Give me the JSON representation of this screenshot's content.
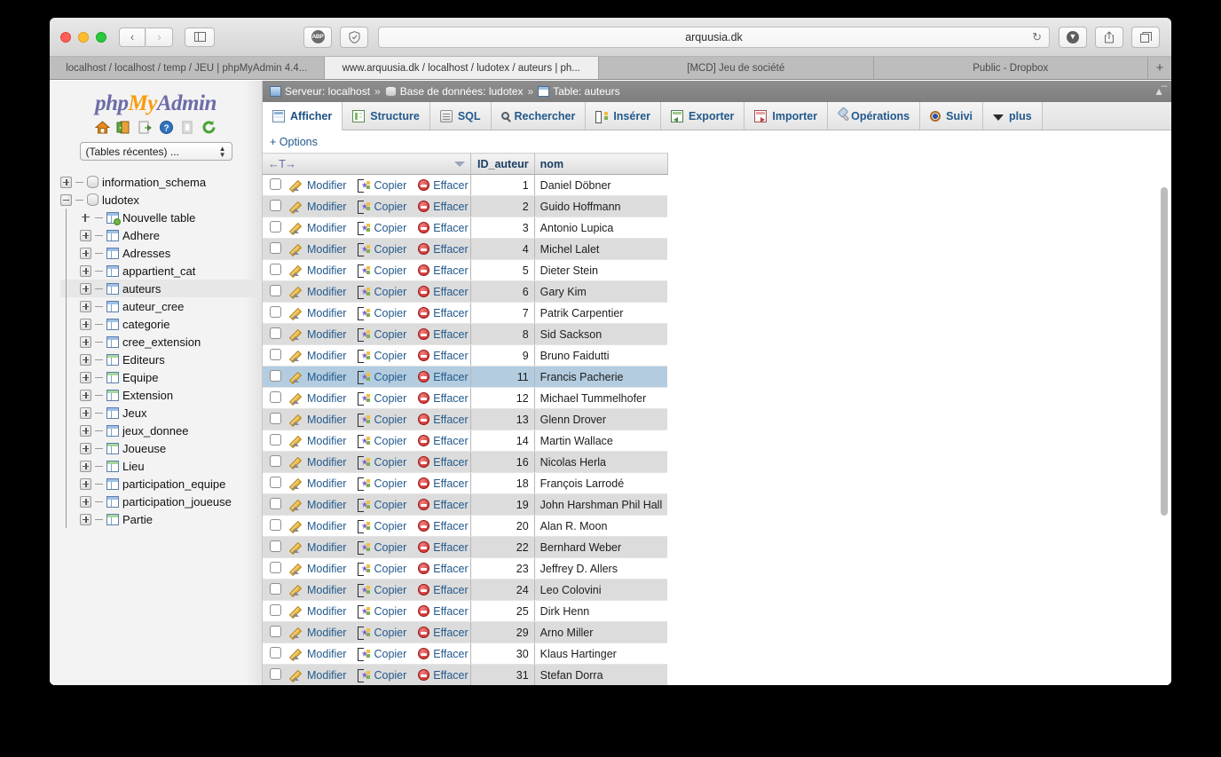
{
  "browser": {
    "url": "arquusia.dk",
    "reload_icon": "reload-icon",
    "back_icon": "chevron-left-icon",
    "forward_icon": "chevron-right-icon",
    "sidebar_icon": "sidebar-toggle-icon",
    "abp_label": "ABP",
    "shield_icon": "shield-icon",
    "download_icon": "download-icon",
    "share_icon": "share-icon",
    "tabs_overview_icon": "tabs-overview-icon",
    "new_tab_label": "+",
    "tabs": [
      {
        "label": "localhost / localhost / temp / JEU | phpMyAdmin 4.4...",
        "active": false
      },
      {
        "label": "www.arquusia.dk / localhost / ludotex / auteurs | ph...",
        "active": true
      },
      {
        "label": "[MCD] Jeu de société",
        "active": false
      },
      {
        "label": "Public - Dropbox",
        "active": false
      }
    ]
  },
  "sidebar": {
    "logo": {
      "php": "php",
      "my": "My",
      "admin": "Admin"
    },
    "nav_icons": [
      "home-icon",
      "exit-icon",
      "export-doc-icon",
      "help-icon",
      "doc-icon",
      "reload-icon"
    ],
    "recent_select": {
      "value": "(Tables récentes) ...",
      "arrows": "⬍"
    },
    "tree": [
      {
        "label": "information_schema",
        "type": "db",
        "level": 0,
        "expander": "plus",
        "selected": false
      },
      {
        "label": "ludotex",
        "type": "db",
        "level": 0,
        "expander": "minus",
        "selected": false
      },
      {
        "label": "Nouvelle table",
        "type": "newtable",
        "level": 1,
        "expander": "none",
        "selected": false
      },
      {
        "label": "Adhere",
        "type": "table",
        "level": 1,
        "expander": "plus",
        "selected": false
      },
      {
        "label": "Adresses",
        "type": "table",
        "level": 1,
        "expander": "plus",
        "selected": false
      },
      {
        "label": "appartient_cat",
        "type": "table",
        "level": 1,
        "expander": "plus",
        "selected": false
      },
      {
        "label": "auteurs",
        "type": "table",
        "level": 1,
        "expander": "plus",
        "selected": true
      },
      {
        "label": "auteur_cree",
        "type": "table",
        "level": 1,
        "expander": "plus",
        "selected": false
      },
      {
        "label": "categorie",
        "type": "table",
        "level": 1,
        "expander": "plus",
        "selected": false
      },
      {
        "label": "cree_extension",
        "type": "table",
        "level": 1,
        "expander": "plus",
        "selected": false
      },
      {
        "label": "Editeurs",
        "type": "table-green",
        "level": 1,
        "expander": "plus",
        "selected": false
      },
      {
        "label": "Equipe",
        "type": "table-green",
        "level": 1,
        "expander": "plus",
        "selected": false
      },
      {
        "label": "Extension",
        "type": "table-green",
        "level": 1,
        "expander": "plus",
        "selected": false
      },
      {
        "label": "Jeux",
        "type": "table",
        "level": 1,
        "expander": "plus",
        "selected": false
      },
      {
        "label": "jeux_donnee",
        "type": "table",
        "level": 1,
        "expander": "plus",
        "selected": false
      },
      {
        "label": "Joueuse",
        "type": "table-green",
        "level": 1,
        "expander": "plus",
        "selected": false
      },
      {
        "label": "Lieu",
        "type": "table-green",
        "level": 1,
        "expander": "plus",
        "selected": false
      },
      {
        "label": "participation_equipe",
        "type": "table",
        "level": 1,
        "expander": "plus",
        "selected": false
      },
      {
        "label": "participation_joueuse",
        "type": "table",
        "level": 1,
        "expander": "plus",
        "selected": false
      },
      {
        "label": "Partie",
        "type": "table-green",
        "level": 1,
        "expander": "plus",
        "selected": false
      }
    ]
  },
  "breadcrumb": {
    "server_label": "Serveur: localhost",
    "db_label": "Base de données: ludotex",
    "table_label": "Table: auteurs",
    "separator": "»",
    "collapse_icon": "collapse-icon"
  },
  "tabs": [
    {
      "label": "Afficher",
      "icon": "grid-icon",
      "active": true
    },
    {
      "label": "Structure",
      "icon": "structure-icon",
      "active": false
    },
    {
      "label": "SQL",
      "icon": "sql-icon",
      "active": false
    },
    {
      "label": "Rechercher",
      "icon": "search-icon",
      "active": false
    },
    {
      "label": "Insérer",
      "icon": "insert-icon",
      "active": false
    },
    {
      "label": "Exporter",
      "icon": "export-icon",
      "active": false
    },
    {
      "label": "Importer",
      "icon": "import-icon",
      "active": false
    },
    {
      "label": "Opérations",
      "icon": "operations-icon",
      "active": false
    },
    {
      "label": "Suivi",
      "icon": "tracking-icon",
      "active": false
    },
    {
      "label": "plus",
      "icon": "chevron-down-icon",
      "active": false
    }
  ],
  "options_link": "+ Options",
  "table": {
    "sort_glyph": "←T→",
    "columns": [
      "ID_auteur",
      "nom"
    ],
    "actions": {
      "edit": "Modifier",
      "copy": "Copier",
      "delete": "Effacer"
    },
    "rows": [
      {
        "id": "1",
        "nom": "Daniel Döbner",
        "marked": false
      },
      {
        "id": "2",
        "nom": "Guido Hoffmann",
        "marked": false
      },
      {
        "id": "3",
        "nom": "Antonio Lupica",
        "marked": false
      },
      {
        "id": "4",
        "nom": "Michel Lalet",
        "marked": false
      },
      {
        "id": "5",
        "nom": "Dieter Stein",
        "marked": false
      },
      {
        "id": "6",
        "nom": "Gary Kim",
        "marked": false
      },
      {
        "id": "7",
        "nom": "Patrik Carpentier",
        "marked": false
      },
      {
        "id": "8",
        "nom": "Sid Sackson",
        "marked": false
      },
      {
        "id": "9",
        "nom": "Bruno Faidutti",
        "marked": false
      },
      {
        "id": "11",
        "nom": "Francis Pacherie",
        "marked": true
      },
      {
        "id": "12",
        "nom": "Michael Tummelhofer",
        "marked": false
      },
      {
        "id": "13",
        "nom": "Glenn Drover",
        "marked": false
      },
      {
        "id": "14",
        "nom": "Martin Wallace",
        "marked": false
      },
      {
        "id": "16",
        "nom": "Nicolas Herla",
        "marked": false
      },
      {
        "id": "18",
        "nom": "François Larrodé",
        "marked": false
      },
      {
        "id": "19",
        "nom": "John Harshman Phil Hall",
        "marked": false
      },
      {
        "id": "20",
        "nom": "Alan R. Moon",
        "marked": false
      },
      {
        "id": "22",
        "nom": "Bernhard Weber",
        "marked": false
      },
      {
        "id": "23",
        "nom": "Jeffrey D. Allers",
        "marked": false
      },
      {
        "id": "24",
        "nom": "Leo Colovini",
        "marked": false
      },
      {
        "id": "25",
        "nom": "Dirk Henn",
        "marked": false
      },
      {
        "id": "29",
        "nom": "Arno Miller",
        "marked": false
      },
      {
        "id": "30",
        "nom": "Klaus Hartinger",
        "marked": false
      },
      {
        "id": "31",
        "nom": "Stefan Dorra",
        "marked": false
      }
    ]
  },
  "colors": {
    "link": "#235a8c",
    "marked_row": "#b3ccdf",
    "even_row": "#dcdcdc",
    "logo_orange": "#f89c0e",
    "logo_blue": "#6c6ca8"
  }
}
